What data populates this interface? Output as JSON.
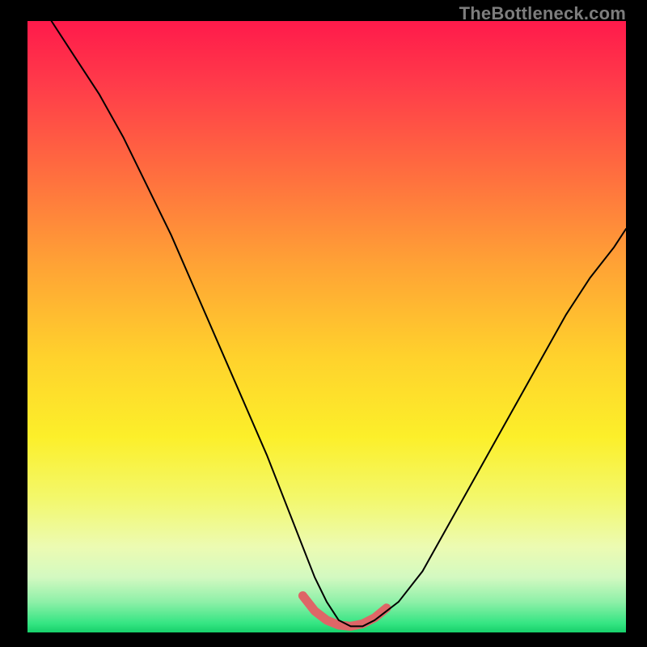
{
  "watermark": "TheBottleneck.com",
  "chart_data": {
    "type": "line",
    "title": "",
    "xlabel": "",
    "ylabel": "",
    "xlim": [
      0,
      100
    ],
    "ylim": [
      0,
      100
    ],
    "series": [
      {
        "name": "bottleneck-curve",
        "x": [
          4,
          8,
          12,
          16,
          20,
          24,
          28,
          32,
          36,
          40,
          44,
          46,
          48,
          50,
          52,
          54,
          56,
          58,
          62,
          66,
          70,
          74,
          78,
          82,
          86,
          90,
          94,
          98,
          100
        ],
        "y": [
          100,
          94,
          88,
          81,
          73,
          65,
          56,
          47,
          38,
          29,
          19,
          14,
          9,
          5,
          2,
          1,
          1,
          2,
          5,
          10,
          17,
          24,
          31,
          38,
          45,
          52,
          58,
          63,
          66
        ]
      }
    ],
    "trough_highlight": {
      "name": "optimal-range",
      "x": [
        46,
        48,
        50,
        52,
        54,
        56,
        58,
        60
      ],
      "y": [
        6,
        3.5,
        2,
        1.2,
        1,
        1.4,
        2.4,
        4
      ]
    },
    "background_gradient_stops": [
      {
        "offset": 0.0,
        "color": "#ff1a4b"
      },
      {
        "offset": 0.1,
        "color": "#ff3a4a"
      },
      {
        "offset": 0.25,
        "color": "#ff6e3f"
      },
      {
        "offset": 0.4,
        "color": "#ffa335"
      },
      {
        "offset": 0.55,
        "color": "#ffd22c"
      },
      {
        "offset": 0.68,
        "color": "#fcef2a"
      },
      {
        "offset": 0.78,
        "color": "#f3f86b"
      },
      {
        "offset": 0.86,
        "color": "#ecfbb2"
      },
      {
        "offset": 0.91,
        "color": "#d3f9c1"
      },
      {
        "offset": 0.95,
        "color": "#8ef0a8"
      },
      {
        "offset": 0.985,
        "color": "#35e583"
      },
      {
        "offset": 1.0,
        "color": "#17d06a"
      }
    ]
  }
}
